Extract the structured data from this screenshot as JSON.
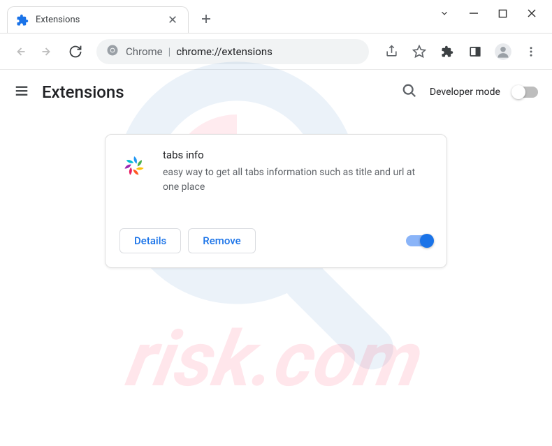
{
  "tab": {
    "title": "Extensions"
  },
  "omnibox": {
    "scheme_label": "Chrome",
    "url": "chrome://extensions"
  },
  "page": {
    "title": "Extensions",
    "developer_mode_label": "Developer mode"
  },
  "extension": {
    "name": "tabs info",
    "description": "easy way to get all tabs information such as title and url at one place",
    "details_label": "Details",
    "remove_label": "Remove",
    "enabled": true
  },
  "watermark": {
    "text": "risk.com"
  }
}
